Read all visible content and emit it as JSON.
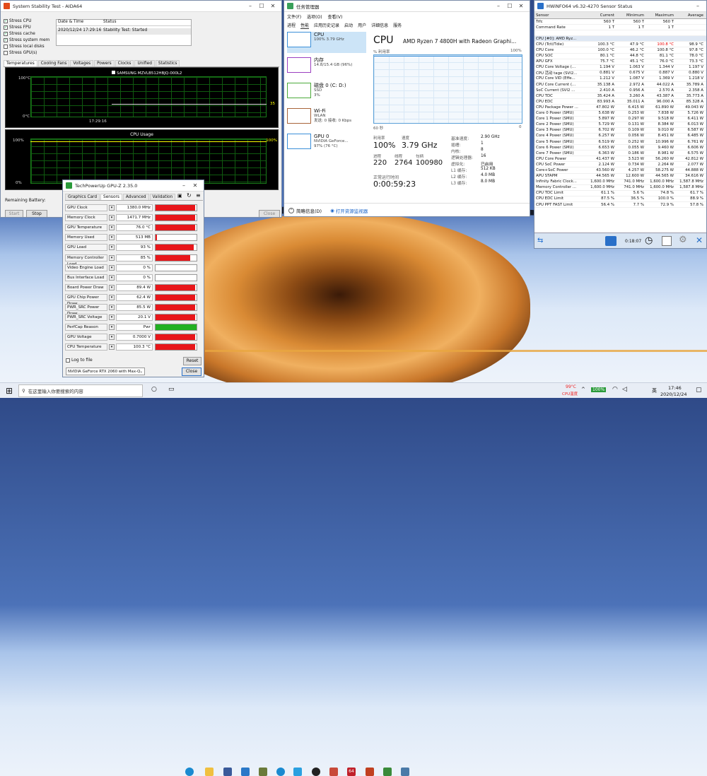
{
  "aida": {
    "title": "System Stability Test - AIDA64",
    "checks": [
      {
        "label": "Stress CPU",
        "on": true
      },
      {
        "label": "Stress FPU",
        "on": true
      },
      {
        "label": "Stress cache",
        "on": true
      },
      {
        "label": "Stress system mem",
        "on": true
      },
      {
        "label": "Stress local disks",
        "on": false
      },
      {
        "label": "Stress GPU(s)",
        "on": false
      }
    ],
    "col_date": "Date & Time",
    "col_status": "Status",
    "row_date": "2020/12/24 17:29:16",
    "row_status": "Stability Test: Started",
    "tabs": [
      "Temperatures",
      "Cooling Fans",
      "Voltages",
      "Powers",
      "Clocks",
      "Unified",
      "Statistics"
    ],
    "temp_legend": "SAMSUNG MZVLB512HBJQ-000L2",
    "temp_top": "100°C",
    "temp_bot": "0°C",
    "temp_val": "35",
    "temp_time": "17:29:16",
    "usage_title": "CPU Usage",
    "usage_top": "100%",
    "usage_bot": "0%",
    "usage_val": "100%",
    "remaining": "Remaining Battery:",
    "btn_start": "Start",
    "btn_stop": "Stop",
    "btn_close": "Close"
  },
  "tm": {
    "title": "任务管理器",
    "menu": [
      "文件(F)",
      "选项(O)",
      "查看(V)"
    ],
    "tabs": [
      "进程",
      "性能",
      "应用历史记录",
      "启动",
      "用户",
      "详细信息",
      "服务"
    ],
    "side": [
      {
        "name": "CPU",
        "sub": "100% 3.79 GHz",
        "color": "#3a8fd9"
      },
      {
        "name": "内存",
        "sub": "14.8/15.4 GB (96%)",
        "color": "#9b3fc0"
      },
      {
        "name": "磁盘 0 (C: D:)",
        "sub": "SSD",
        "sub2": "3%",
        "color": "#4caa3a"
      },
      {
        "name": "Wi-Fi",
        "sub": "WLAN",
        "sub2": "发送: 0 接收: 0 Kbps",
        "color": "#a8643a"
      },
      {
        "name": "GPU 0",
        "sub": "NVIDIA GeForce...",
        "sub2": "97% (76 °C)",
        "color": "#3a8fd9"
      }
    ],
    "cpu_title": "CPU",
    "cpu_model": "AMD Ryzen 7 4800H with Radeon Graphi...",
    "util_label": "% 利用率",
    "util_max": "100%",
    "sec": "60 秒",
    "zero": "0",
    "stats": [
      {
        "k": "利用率",
        "v": "100%"
      },
      {
        "k": "速度",
        "v": "3.79 GHz"
      },
      {
        "k": "进程",
        "v": "220"
      },
      {
        "k": "线程",
        "v": "2764"
      },
      {
        "k": "句柄",
        "v": "100980"
      }
    ],
    "uptime_label": "正常运行时间",
    "uptime": "0:00:59:23",
    "specs": [
      [
        "基准速度:",
        "2.90 GHz"
      ],
      [
        "插槽:",
        "1"
      ],
      [
        "内核:",
        "8"
      ],
      [
        "逻辑处理器:",
        "16"
      ],
      [
        "虚拟化:",
        "已启用"
      ],
      [
        "L1 缓存:",
        "512 KB"
      ],
      [
        "L2 缓存:",
        "4.0 MB"
      ],
      [
        "L3 缓存:",
        "8.0 MB"
      ]
    ],
    "brief": "简略信息(D)",
    "monitor": "打开资源监视器"
  },
  "hw": {
    "title": "HWiNFO64 v6.32-4270 Sensor Status",
    "cols": [
      "Sensor",
      "Current",
      "Minimum",
      "Maximum",
      "Average"
    ],
    "rows": [
      [
        "Trfc",
        "560 T",
        "560 T",
        "560 T",
        ""
      ],
      [
        "Command Rate",
        "1 T",
        "1 T",
        "1 T",
        ""
      ],
      [
        "",
        "",
        "",
        "",
        ""
      ],
      [
        "CPU [#0]: AMD Ryz...",
        "",
        "",
        "",
        ""
      ],
      [
        "CPU (Tctl/Tdie)",
        "100.3 °C",
        "47.9 °C",
        "100.8 °C",
        "98.9 °C"
      ],
      [
        "CPU Core",
        "100.0 °C",
        "46.2 °C",
        "100.8 °C",
        "97.8 °C"
      ],
      [
        "CPU SOC",
        "80.1 °C",
        "44.8 °C",
        "81.1 °C",
        "78.0 °C"
      ],
      [
        "APU GFX",
        "75.7 °C",
        "45.1 °C",
        "76.0 °C",
        "73.3 °C"
      ],
      [
        "CPU Core Voltage (...",
        "1.194 V",
        "1.063 V",
        "1.344 V",
        "1.197 V"
      ],
      [
        "CPU 活动 tage (SVI2...",
        "0.881 V",
        "0.675 V",
        "0.887 V",
        "0.880 V"
      ],
      [
        "CPU Core VID (Effe...",
        "1.212 V",
        "1.087 V",
        "1.369 V",
        "1.218 V"
      ],
      [
        "CPU Core Current (...",
        "35.138 A",
        "2.972 A",
        "44.022 A",
        "35.789 A"
      ],
      [
        "SoC Current (SVI2 ...",
        "2.410 A",
        "0.956 A",
        "2.570 A",
        "2.358 A"
      ],
      [
        "CPU TDC",
        "35.424 A",
        "3.260 A",
        "43.387 A",
        "35.773 A"
      ],
      [
        "CPU EDC",
        "83.993 A",
        "35.011 A",
        "96.000 A",
        "85.328 A"
      ],
      [
        "CPU Package Power ...",
        "47.802 W",
        "6.415 W",
        "61.890 W",
        "49.043 W"
      ],
      [
        "Core 0 Power (SMU)",
        "5.638 W",
        "0.253 W",
        "7.838 W",
        "5.726 W"
      ],
      [
        "Core 1 Power (SMU)",
        "5.897 W",
        "0.297 W",
        "9.518 W",
        "6.411 W"
      ],
      [
        "Core 2 Power (SMU)",
        "5.729 W",
        "0.131 W",
        "8.384 W",
        "6.013 W"
      ],
      [
        "Core 3 Power (SMU)",
        "6.702 W",
        "0.109 W",
        "9.010 W",
        "6.587 W"
      ],
      [
        "Core 4 Power (SMU)",
        "6.257 W",
        "0.056 W",
        "8.451 W",
        "6.485 W"
      ],
      [
        "Core 5 Power (SMU)",
        "6.519 W",
        "0.252 W",
        "10.996 W",
        "6.761 W"
      ],
      [
        "Core 6 Power (SMU)",
        "6.653 W",
        "0.055 W",
        "9.460 W",
        "6.606 W"
      ],
      [
        "Core 7 Power (SMU)",
        "6.363 W",
        "0.186 W",
        "8.981 W",
        "6.575 W"
      ],
      [
        "CPU Core Power",
        "41.437 W",
        "3.523 W",
        "56.260 W",
        "42.812 W"
      ],
      [
        "CPU SoC Power",
        "2.124 W",
        "0.734 W",
        "2.264 W",
        "2.077 W"
      ],
      [
        "Core+SoC Power",
        "43.560 W",
        "4.257 W",
        "58.275 W",
        "44.888 W"
      ],
      [
        "APU STAPM",
        "44.565 W",
        "12.600 W",
        "44.565 W",
        "34.616 W"
      ],
      [
        "Infinity Fabric Clock...",
        "1,600.0 MHz",
        "741.0 MHz",
        "1,600.0 MHz",
        "1,587.8 MHz"
      ],
      [
        "Memory Controller ...",
        "1,600.0 MHz",
        "741.0 MHz",
        "1,600.0 MHz",
        "1,587.8 MHz"
      ],
      [
        "CPU TDC Limit",
        "61.1 %",
        "5.6 %",
        "74.8 %",
        "61.7 %"
      ],
      [
        "CPU EDC Limit",
        "87.5 %",
        "36.5 %",
        "100.0 %",
        "88.9 %"
      ],
      [
        "CPU PPT FAST Limit",
        "56.4 %",
        "7.7 %",
        "72.9 %",
        "57.8 %"
      ]
    ],
    "time": "0:18:07"
  },
  "gpuz": {
    "title": "TechPowerUp GPU-Z 2.35.0",
    "tabs": [
      "Graphics Card",
      "Sensors",
      "Advanced",
      "Validation"
    ],
    "rows": [
      {
        "k": "GPU Clock",
        "v": "1380.0 MHz",
        "f": 0.97
      },
      {
        "k": "Memory Clock",
        "v": "1471.7 MHz",
        "f": 0.97
      },
      {
        "k": "GPU Temperature",
        "v": "76.0 °C",
        "f": 0.97
      },
      {
        "k": "Memory Used",
        "v": "513 MB",
        "f": 0.03
      },
      {
        "k": "GPU Load",
        "v": "93 %",
        "f": 0.93
      },
      {
        "k": "Memory Controller Load",
        "v": "85 %",
        "f": 0.85
      },
      {
        "k": "Video Engine Load",
        "v": "0 %",
        "f": 0
      },
      {
        "k": "Bus Interface Load",
        "v": "0 %",
        "f": 0
      },
      {
        "k": "Board Power Draw",
        "v": "89.4 W",
        "f": 0.97
      },
      {
        "k": "GPU Chip Power Draw",
        "v": "62.4 W",
        "f": 0.97
      },
      {
        "k": "PWR_SRC Power Draw",
        "v": "85.5 W",
        "f": 0.97
      },
      {
        "k": "PWR_SRC Voltage",
        "v": "20.1 V",
        "f": 0.97
      },
      {
        "k": "PerfCap Reason",
        "v": "Pwr",
        "f": 1,
        "green": true
      },
      {
        "k": "GPU Voltage",
        "v": "0.7000 V",
        "f": 0.97
      },
      {
        "k": "CPU Temperature",
        "v": "100.3 °C",
        "f": 0.97
      }
    ],
    "log": "Log to file",
    "reset": "Reset",
    "device": "NVIDIA GeForce RTX 2060 with Max-Q",
    "close": "Close"
  },
  "taskbar": {
    "search": "在这里输入你要搜索的内容",
    "cpu_temp": "99°C",
    "cpu_temp_label": "CPU温度",
    "battery": "100%",
    "time": "17:46",
    "date": "2020/12/24",
    "ime": "英"
  }
}
